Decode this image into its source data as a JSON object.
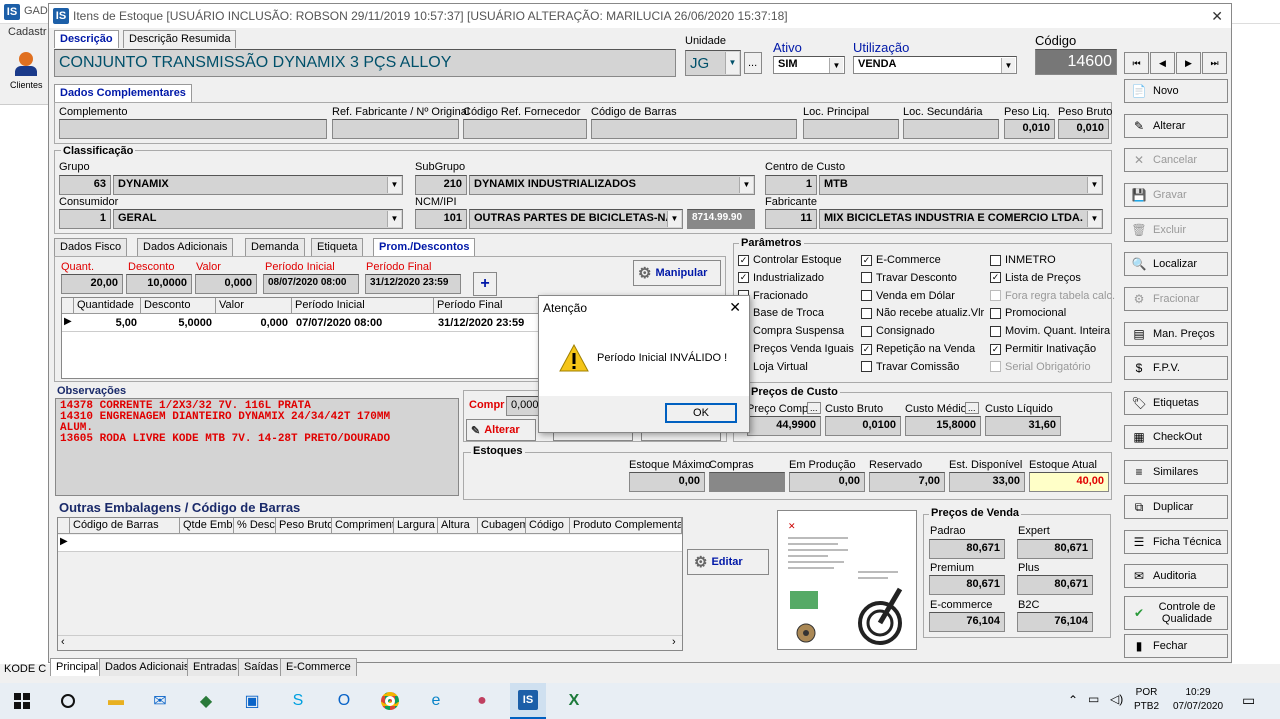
{
  "bg": {
    "title": "GAD",
    "menu": "Cadastr",
    "clientes": "Clientes",
    "status": "KODE C"
  },
  "window": {
    "title": "Itens de Estoque  [USUÁRIO INCLUSÃO: ROBSON 29/11/2019 10:57:37]  [USUÁRIO ALTERAÇÃO: MARILUCIA 26/06/2020 15:37:18]",
    "close": "✕"
  },
  "top": {
    "tab_desc": "Descrição",
    "tab_desc_res": "Descrição Resumida",
    "descricao": "CONJUNTO TRANSMISSÃO DYNAMIX 3 PÇS  ALLOY",
    "unidade_lbl": "Unidade",
    "unidade": "JG",
    "ellipsis": "...",
    "ativo_lbl": "Ativo",
    "ativo": "SIM",
    "util_lbl": "Utilização",
    "util": "VENDA",
    "codigo_lbl": "Código",
    "codigo": "14600"
  },
  "nav": {
    "first": "⏮",
    "prev": "◀",
    "next": "▶",
    "last": "⏭"
  },
  "right_buttons": [
    {
      "label": "Novo",
      "icon": "📄",
      "en": true
    },
    {
      "label": "Alterar",
      "icon": "✎",
      "en": true
    },
    {
      "label": "Cancelar",
      "icon": "✕",
      "en": false
    },
    {
      "label": "Gravar",
      "icon": "💾",
      "en": false
    },
    {
      "label": "Excluir",
      "icon": "🗑",
      "en": false
    },
    {
      "label": "Localizar",
      "icon": "🔍",
      "en": true
    },
    {
      "label": "Fracionar",
      "icon": "⚙",
      "en": false
    },
    {
      "label": "Man. Preços",
      "icon": "▤",
      "en": true
    },
    {
      "label": "F.P.V.",
      "icon": "$",
      "en": true
    },
    {
      "label": "Etiquetas",
      "icon": "🏷",
      "en": true
    },
    {
      "label": "CheckOut",
      "icon": "▦",
      "en": true
    },
    {
      "label": "Similares",
      "icon": "≡",
      "en": true
    },
    {
      "label": "Duplicar",
      "icon": "⧉",
      "en": true
    },
    {
      "label": "Ficha Técnica",
      "icon": "☰",
      "en": true
    },
    {
      "label": "Auditoria",
      "icon": "✉",
      "en": true
    },
    {
      "label": "Controle de Qualidade",
      "icon": "✔",
      "en": true
    },
    {
      "label": "Fechar",
      "icon": "▮",
      "en": true
    }
  ],
  "dados": {
    "title": "Dados Complementares",
    "complemento": "Complemento",
    "ref_fab": "Ref. Fabricante / Nº Original",
    "cod_ref_forn": "Código Ref. Fornecedor",
    "cod_barras": "Código de Barras",
    "loc_pri": "Loc. Principal",
    "loc_sec": "Loc. Secundária",
    "peso_liq_lbl": "Peso Liq.",
    "peso_bruto_lbl": "Peso Bruto",
    "peso_liq": "0,010",
    "peso_bruto": "0,010"
  },
  "class": {
    "title": "Classificação",
    "grupo_lbl": "Grupo",
    "grupo_cod": "63",
    "grupo": "DYNAMIX",
    "subgrupo_lbl": "SubGrupo",
    "subgrupo_cod": "210",
    "subgrupo": "DYNAMIX INDUSTRIALIZADOS",
    "cc_lbl": "Centro de Custo",
    "cc_cod": "1",
    "cc": "MTB",
    "cons_lbl": "Consumidor",
    "cons_cod": "1",
    "cons": "GERAL",
    "ncm_lbl": "NCM/IPI",
    "ncm_cod": "101",
    "ncm": "OUTRAS PARTES DE BICICLETAS-NACIO",
    "ncm_num": "8714.99.90",
    "fab_lbl": "Fabricante",
    "fab_cod": "11",
    "fab": "MIX BICICLETAS INDUSTRIA E COMERCIO LTDA."
  },
  "tabs": [
    "Dados Fisco",
    "Dados Adicionais",
    "Demanda",
    "Etiqueta",
    "Prom./Descontos"
  ],
  "promo": {
    "quant_lbl": "Quant.",
    "desc_lbl": "Desconto",
    "valor_lbl": "Valor",
    "pi_lbl": "Período Inicial",
    "pf_lbl": "Período Final",
    "quant": "20,00",
    "desc": "10,0000",
    "valor": "0,000",
    "pi": "08/07/2020 08:00",
    "pf": "31/12/2020 23:59",
    "plus": "+",
    "manipular": "Manipular",
    "cols": [
      "Quantidade",
      "Desconto",
      "Valor",
      "Período Inicial",
      "Período Final"
    ],
    "row": [
      "5,00",
      "5,0000",
      "0,000",
      "07/07/2020 08:00",
      "31/12/2020 23:59"
    ]
  },
  "param": {
    "title": "Parâmetros",
    "items": [
      {
        "l": "Controlar Estoque",
        "c": true,
        "d": false
      },
      {
        "l": "E-Commerce",
        "c": true,
        "d": false
      },
      {
        "l": "INMETRO",
        "c": false,
        "d": false
      },
      {
        "l": "Industrializado",
        "c": true,
        "d": false
      },
      {
        "l": "Travar Desconto",
        "c": false,
        "d": false
      },
      {
        "l": "Lista de Preços",
        "c": true,
        "d": false
      },
      {
        "l": "Fracionado",
        "c": false,
        "d": false
      },
      {
        "l": "Venda em Dólar",
        "c": false,
        "d": false
      },
      {
        "l": "Fora regra tabela calc.",
        "c": false,
        "d": true
      },
      {
        "l": "Base de Troca",
        "c": false,
        "d": false
      },
      {
        "l": "Não recebe atualiz.Vlr",
        "c": false,
        "d": false
      },
      {
        "l": "Promocional",
        "c": false,
        "d": false
      },
      {
        "l": "Compra Suspensa",
        "c": false,
        "d": false
      },
      {
        "l": "Consignado",
        "c": false,
        "d": false
      },
      {
        "l": "Movim. Quant. Inteira",
        "c": false,
        "d": false
      },
      {
        "l": "Preços Venda Iguais",
        "c": false,
        "d": false
      },
      {
        "l": "Repetição na Venda",
        "c": true,
        "d": false
      },
      {
        "l": "Permitir Inativação",
        "c": true,
        "d": false
      },
      {
        "l": "Loja Virtual",
        "c": false,
        "d": false
      },
      {
        "l": "Travar Comissão",
        "c": false,
        "d": false
      },
      {
        "l": "Serial Obrigatório",
        "c": false,
        "d": true
      }
    ]
  },
  "custo": {
    "title": "Preços de Custo",
    "compra_lbl": "Preço Compra",
    "compra": "44,9900",
    "bruto_lbl": "Custo Bruto",
    "bruto": "0,0100",
    "medio_lbl": "Custo Médio",
    "medio": "15,8000",
    "liq_lbl": "Custo Líquido",
    "liq": "31,60"
  },
  "obs": {
    "title": "Observações",
    "lines": [
      "14378    CORRENTE 1/2X3/32 7V. 116L PRATA",
      "14310    ENGRENAGEM DIANTEIRO DYNAMIX 24/34/42T 170MM",
      "ALUM.",
      "13605    RODA LIVRE KODE MTB 7V. 14-28T PRETO/DOURADO"
    ]
  },
  "compr": {
    "lbl": "Compr",
    "val": "0,000",
    "alterar": "Alterar"
  },
  "estoque": {
    "title": "Estoques",
    "max_lbl": "Estoque Máximo",
    "max": "0,00",
    "compras_lbl": "Compras",
    "compras": "",
    "prod_lbl": "Em Produção",
    "prod": "0,00",
    "res_lbl": "Reservado",
    "res": "7,00",
    "disp_lbl": "Est. Disponível",
    "disp": "33,00",
    "atual_lbl": "Estoque Atual",
    "atual": "40,00"
  },
  "emb": {
    "title": "Outras Embalagens / Código de Barras",
    "cols": [
      "Código de Barras",
      "Qtde Emb.",
      "% Desc.",
      "Peso Bruto",
      "Comprimento",
      "Largura",
      "Altura",
      "Cubagem",
      "Código",
      "Produto Complementar"
    ],
    "editar": "Editar"
  },
  "venda": {
    "title": "Preços de Venda",
    "padrao_lbl": "Padrao",
    "padrao": "80,671",
    "expert_lbl": "Expert",
    "expert": "80,671",
    "premium_lbl": "Premium",
    "premium": "80,671",
    "plus_lbl": "Plus",
    "plus": "80,671",
    "ecom_lbl": "E-commerce",
    "ecom": "76,104",
    "b2c_lbl": "B2C",
    "b2c": "76,104"
  },
  "bottom_tabs": [
    "Principal",
    "Dados Adicionais",
    "Entradas",
    "Saídas",
    "E-Commerce"
  ],
  "dialog": {
    "title": "Atenção",
    "msg": "Período Inicial INVÁLIDO !",
    "ok": "OK",
    "close": "✕"
  },
  "taskbar": {
    "lang1": "POR",
    "lang2": "PTB2",
    "time": "10:29",
    "date": "07/07/2020"
  }
}
